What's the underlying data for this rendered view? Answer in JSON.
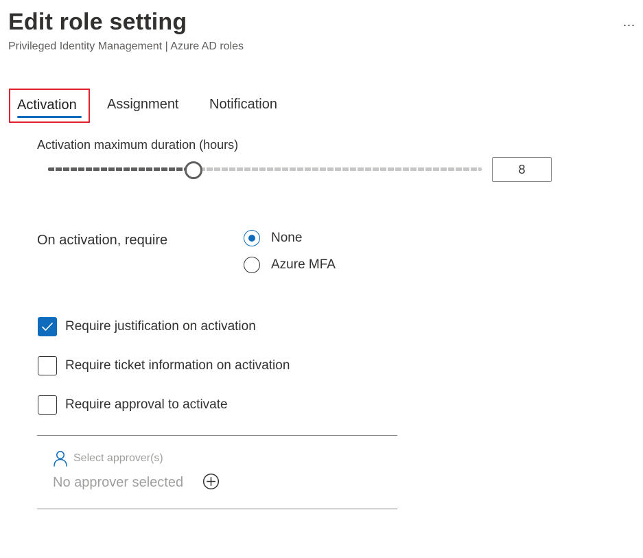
{
  "header": {
    "title": "Edit role setting",
    "breadcrumb": "Privileged Identity Management | Azure AD roles",
    "more_label": "..."
  },
  "tabs": [
    {
      "label": "Activation",
      "selected": true,
      "highlighted": true
    },
    {
      "label": "Assignment",
      "selected": false
    },
    {
      "label": "Notification",
      "selected": false
    }
  ],
  "activation": {
    "duration_label": "Activation maximum duration (hours)",
    "duration_value": "8",
    "duration_min": 0,
    "duration_max": 24,
    "require_label": "On activation, require",
    "radio_options": [
      {
        "label": "None",
        "checked": true
      },
      {
        "label": "Azure MFA",
        "checked": false
      }
    ],
    "checkboxes": [
      {
        "label": "Require justification on activation",
        "checked": true
      },
      {
        "label": "Require ticket information on activation",
        "checked": false
      },
      {
        "label": "Require approval to activate",
        "checked": false
      }
    ],
    "approver": {
      "select_label": "Select approver(s)",
      "empty_text": "No approver selected",
      "user_icon": "person-icon",
      "add_icon": "add-circle-icon"
    }
  },
  "colors": {
    "accent": "#0f6cbd",
    "highlight_border": "#e0202a",
    "text": "#323130",
    "muted": "#a19f9d"
  }
}
